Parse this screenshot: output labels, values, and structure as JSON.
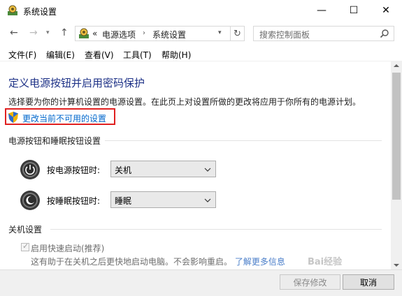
{
  "window": {
    "title": "系统设置",
    "controls": {
      "minimize": "—",
      "maximize": "☐",
      "close": "✕"
    }
  },
  "nav": {
    "back": "←",
    "forward": "→",
    "recent": "▾",
    "up": "↑",
    "address": {
      "prefix": "«",
      "segments": [
        "电源选项",
        "系统设置"
      ],
      "separator": "›"
    },
    "refresh": "↻",
    "search_placeholder": "搜索控制面板"
  },
  "menu": [
    "文件(F)",
    "编辑(E)",
    "查看(V)",
    "工具(T)",
    "帮助(H)"
  ],
  "content": {
    "title": "定义电源按钮并启用密码保护",
    "description": "选择要为你的计算机设置的电源设置。在此页上对设置所做的更改将应用于你所有的电源计划。",
    "change_link": "更改当前不可用的设置",
    "buttons_section": "电源按钮和睡眠按钮设置",
    "power_button": {
      "label": "按电源按钮时:",
      "value": "关机"
    },
    "sleep_button": {
      "label": "按睡眠按钮时:",
      "value": "睡眠"
    },
    "shutdown_section": "关机设置",
    "fast_startup": {
      "label": "启用快速启动(推荐)",
      "checked": true,
      "desc": "这有助于在关机之后更快地启动电脑。不会影响重启。",
      "link": "了解更多信息"
    }
  },
  "footer": {
    "save": "保存修改",
    "cancel": "取消"
  },
  "watermark": "Bai经验",
  "colors": {
    "title": "#1e3287",
    "link": "#0066cc",
    "highlight": "#e02020"
  }
}
